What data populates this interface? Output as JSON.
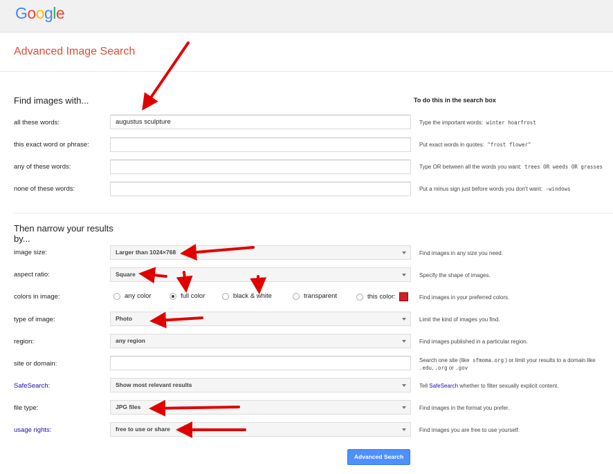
{
  "logo": {
    "text": "Google",
    "letters": [
      "G",
      "o",
      "o",
      "g",
      "l",
      "e"
    ],
    "colors": [
      "#4285f4",
      "#ea4335",
      "#fbbc05",
      "#4285f4",
      "#34a853",
      "#ea4335"
    ]
  },
  "page_title": "Advanced Image Search",
  "find_section": {
    "title": "Find images with...",
    "hint_title": "To do this in the search box",
    "rows": [
      {
        "label": "all these words:",
        "value": "augustus sculpture",
        "hint_text": "Type the important words:",
        "hint_example": "winter hoarfrost"
      },
      {
        "label": "this exact word or phrase:",
        "value": "",
        "hint_text": "Put exact words in quotes:",
        "hint_example": "\"frost flower\""
      },
      {
        "label": "any of these words:",
        "value": "",
        "hint_text": "Type OR between all the words you want:",
        "hint_example": "trees OR weeds OR grasses"
      },
      {
        "label": "none of these words:",
        "value": "",
        "hint_text": "Put a minus sign just before words you don't want:",
        "hint_example": "-windows"
      }
    ]
  },
  "narrow_section": {
    "title_line1": "Then narrow your results",
    "title_line2": "by...",
    "image_size": {
      "label": "image size:",
      "value": "Larger than 1024×768",
      "hint": "Find images in any size you need."
    },
    "aspect_ratio": {
      "label": "aspect ratio:",
      "value": "Square",
      "hint": "Specify the shape of images."
    },
    "colors": {
      "label": "colors in image:",
      "options": [
        "any color",
        "full color",
        "black & white",
        "transparent",
        "this color:"
      ],
      "selected": "full color",
      "swatch_color": "#d0202a",
      "hint": "Find images in your preferred colors."
    },
    "type_of_image": {
      "label": "type of image:",
      "value": "Photo",
      "hint": "Limit the kind of images you find."
    },
    "region": {
      "label": "region:",
      "value": "any region",
      "hint": "Find images published in a particular region."
    },
    "site": {
      "label": "site or domain:",
      "value": "",
      "hint_pre": "Search one site (like",
      "hint_site": "sfmoma.org",
      "hint_mid": ") or limit your results to a domain like",
      "hint_d1": ".edu",
      "hint_d2": ".org",
      "hint_or": "or",
      "hint_d3": ".gov"
    },
    "safesearch": {
      "label": "SafeSearch:",
      "value": "Show most relevant results",
      "hint_pre": "Tell",
      "hint_link": "SafeSearch",
      "hint_post": "whether to filter sexually explicit content."
    },
    "file_type": {
      "label": "file type:",
      "value": "JPG files",
      "hint": "Find images in the format you prefer."
    },
    "usage_rights": {
      "label": "usage rights:",
      "value": "free to use or share",
      "hint": "Find images you are free to use yourself."
    }
  },
  "submit_button": "Advanced Search",
  "accent_colors": {
    "title_red": "#dd4b39",
    "link_blue": "#1a0dab",
    "button_blue": "#4d90fe",
    "annotation_arrow": "#e00000"
  }
}
